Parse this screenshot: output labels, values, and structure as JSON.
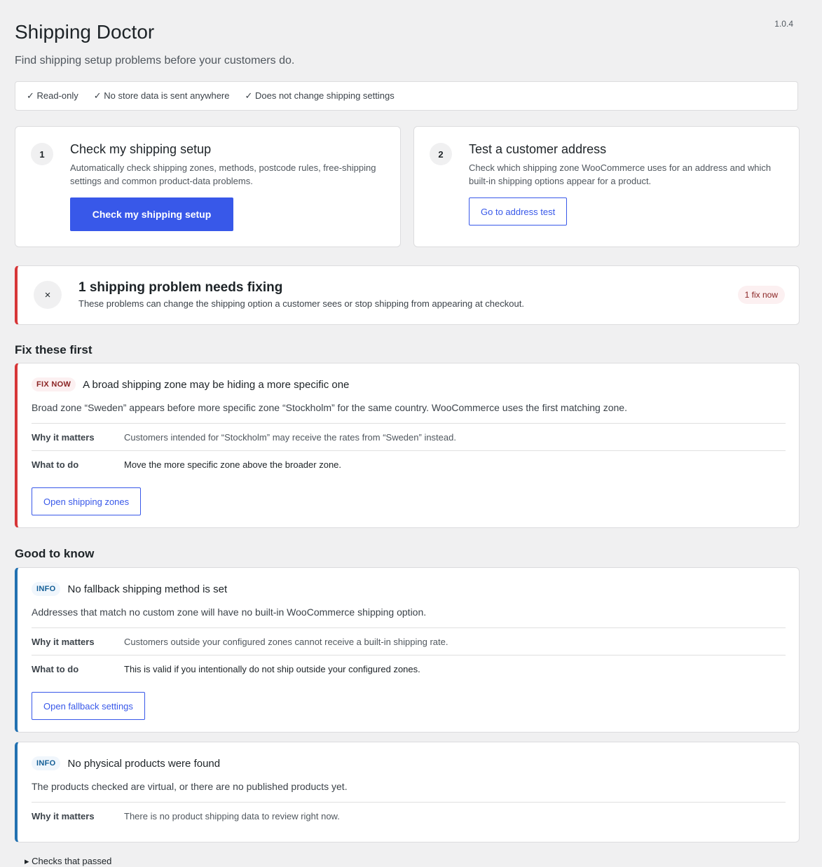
{
  "version": "1.0.4",
  "title": "Shipping Doctor",
  "subtitle": "Find shipping setup problems before your customers do.",
  "trust": [
    "✓ Read-only",
    "✓ No store data is sent anywhere",
    "✓ Does not change shipping settings"
  ],
  "steps": [
    {
      "number": "1",
      "title": "Check my shipping setup",
      "description": "Automatically check shipping zones, methods, postcode rules, free-shipping settings and common product-data problems.",
      "button": "Check my shipping setup"
    },
    {
      "number": "2",
      "title": "Test a customer address",
      "description": "Check which shipping zone WooCommerce uses for an address and which built-in shipping options appear for a product.",
      "button": "Go to address test"
    }
  ],
  "summary": {
    "icon": "×",
    "title": "1 shipping problem needs fixing",
    "description": "These problems can change the shipping option a customer sees or stop shipping from appearing at checkout.",
    "badge": "1 fix now"
  },
  "sections": {
    "fix_first": "Fix these first",
    "good_to_know": "Good to know"
  },
  "issues": [
    {
      "badge": "FIX NOW",
      "title": "A broad shipping zone may be hiding a more specific one",
      "description": "Broad zone “Sweden” appears before more specific zone “Stockholm” for the same country. WooCommerce uses the first matching zone.",
      "why_label": "Why it matters",
      "why": "Customers intended for “Stockholm” may receive the rates from “Sweden” instead.",
      "what_label": "What to do",
      "what": "Move the more specific zone above the broader zone.",
      "button": "Open shipping zones"
    },
    {
      "badge": "INFO",
      "title": "No fallback shipping method is set",
      "description": "Addresses that match no custom zone will have no built-in WooCommerce shipping option.",
      "why_label": "Why it matters",
      "why": "Customers outside your configured zones cannot receive a built-in shipping rate.",
      "what_label": "What to do",
      "what": "This is valid if you intentionally do not ship outside your configured zones.",
      "button": "Open fallback settings"
    },
    {
      "badge": "INFO",
      "title": "No physical products were found",
      "description": "The products checked are virtual, or there are no published products yet.",
      "why_label": "Why it matters",
      "why": "There is no product shipping data to review right now."
    }
  ],
  "footer_peek": "▸ Checks that passed"
}
